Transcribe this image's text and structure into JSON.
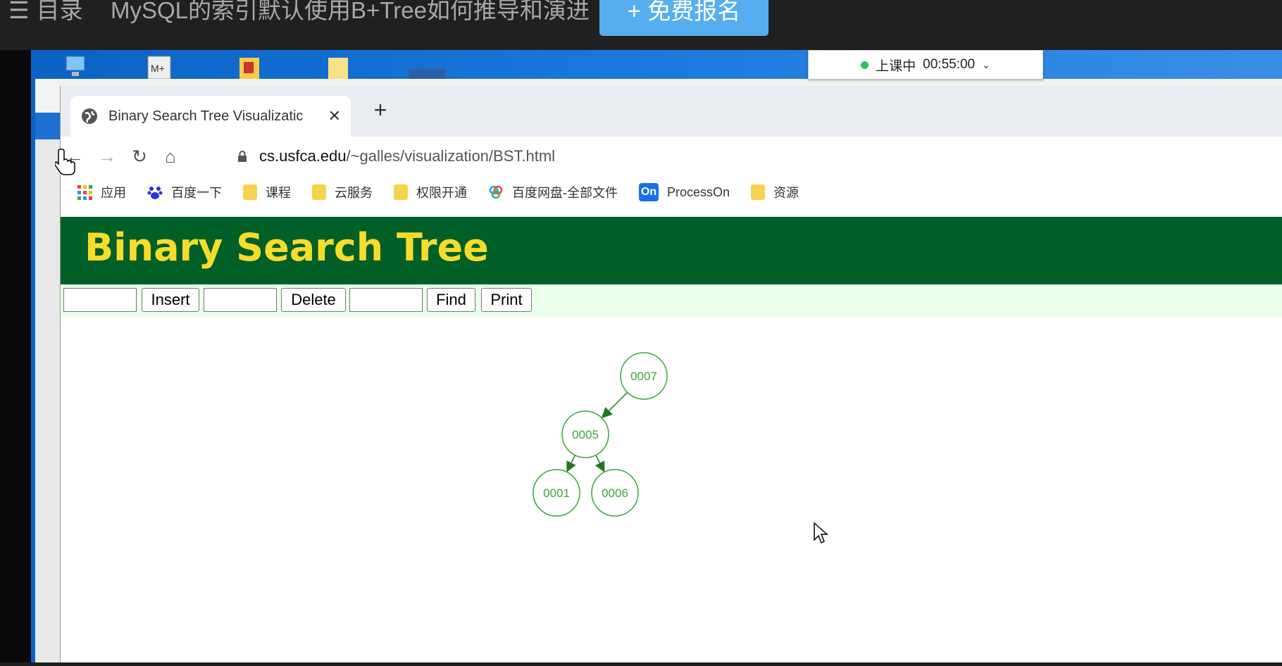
{
  "course_bar": {
    "menu_icon": "hamburger-icon",
    "menu_label": "目录",
    "title": "MySQL的索引默认使用B+Tree如何推导和演进",
    "signup_label": "+ 免费报名"
  },
  "timer": {
    "status": "上课中",
    "time": "00:55:00",
    "status_color": "#21c55d"
  },
  "browser": {
    "tab": {
      "title": "Binary Search Tree Visualizatic",
      "icon": "globe-icon"
    },
    "url": {
      "host": "cs.usfca.edu",
      "path": "/~galles/visualization/BST.html"
    },
    "bookmarks": [
      {
        "label": "应用",
        "icon": "apps-grid-icon"
      },
      {
        "label": "百度一下",
        "icon": "baidu-paw-icon"
      },
      {
        "label": "课程",
        "icon": "folder-icon"
      },
      {
        "label": "云服务",
        "icon": "folder-icon"
      },
      {
        "label": "权限开通",
        "icon": "folder-icon"
      },
      {
        "label": "百度网盘-全部文件",
        "icon": "baidu-netdisk-icon"
      },
      {
        "label": "ProcessOn",
        "icon": "processon-icon"
      },
      {
        "label": "资源",
        "icon": "folder-icon"
      }
    ],
    "processon_badge": "On"
  },
  "page": {
    "title": "Binary Search Tree",
    "header_color": "#006028",
    "title_color": "#f7dc2c",
    "controls": {
      "insert_label": "Insert",
      "delete_label": "Delete",
      "find_label": "Find",
      "print_label": "Print"
    }
  },
  "tree": {
    "node_color": "#3aa63a",
    "nodes": [
      {
        "id": "n7",
        "label": "0007"
      },
      {
        "id": "n5",
        "label": "0005"
      },
      {
        "id": "n1",
        "label": "0001"
      },
      {
        "id": "n6",
        "label": "0006"
      }
    ],
    "edges": [
      {
        "from": "n7",
        "to": "n5"
      },
      {
        "from": "n5",
        "to": "n1"
      },
      {
        "from": "n5",
        "to": "n6"
      }
    ]
  }
}
